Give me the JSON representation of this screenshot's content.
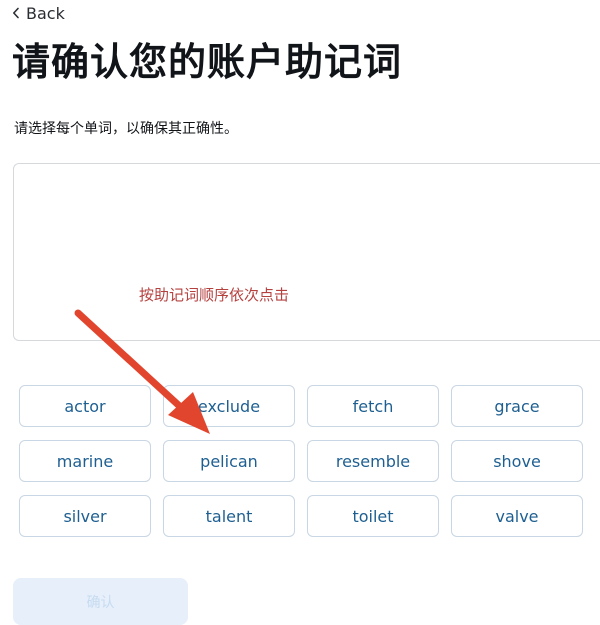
{
  "header": {
    "back_label": "Back",
    "title": "请确认您的账户助记词",
    "subtitle": "请选择每个单词，以确保其正确性。"
  },
  "drop_area": {
    "hint": "按助记词顺序依次点击"
  },
  "words": [
    "actor",
    "exclude",
    "fetch",
    "grace",
    "marine",
    "pelican",
    "resemble",
    "shove",
    "silver",
    "talent",
    "toilet",
    "valve"
  ],
  "footer": {
    "continue_label": "确认"
  },
  "colors": {
    "hint_text": "#b5413f",
    "word_text": "#1e5f91",
    "arrow": "#e2452d",
    "button_disabled_bg": "#e6effa"
  },
  "icons": {
    "back": "chevron-left-icon",
    "annotation": "arrow-annotation-icon"
  }
}
